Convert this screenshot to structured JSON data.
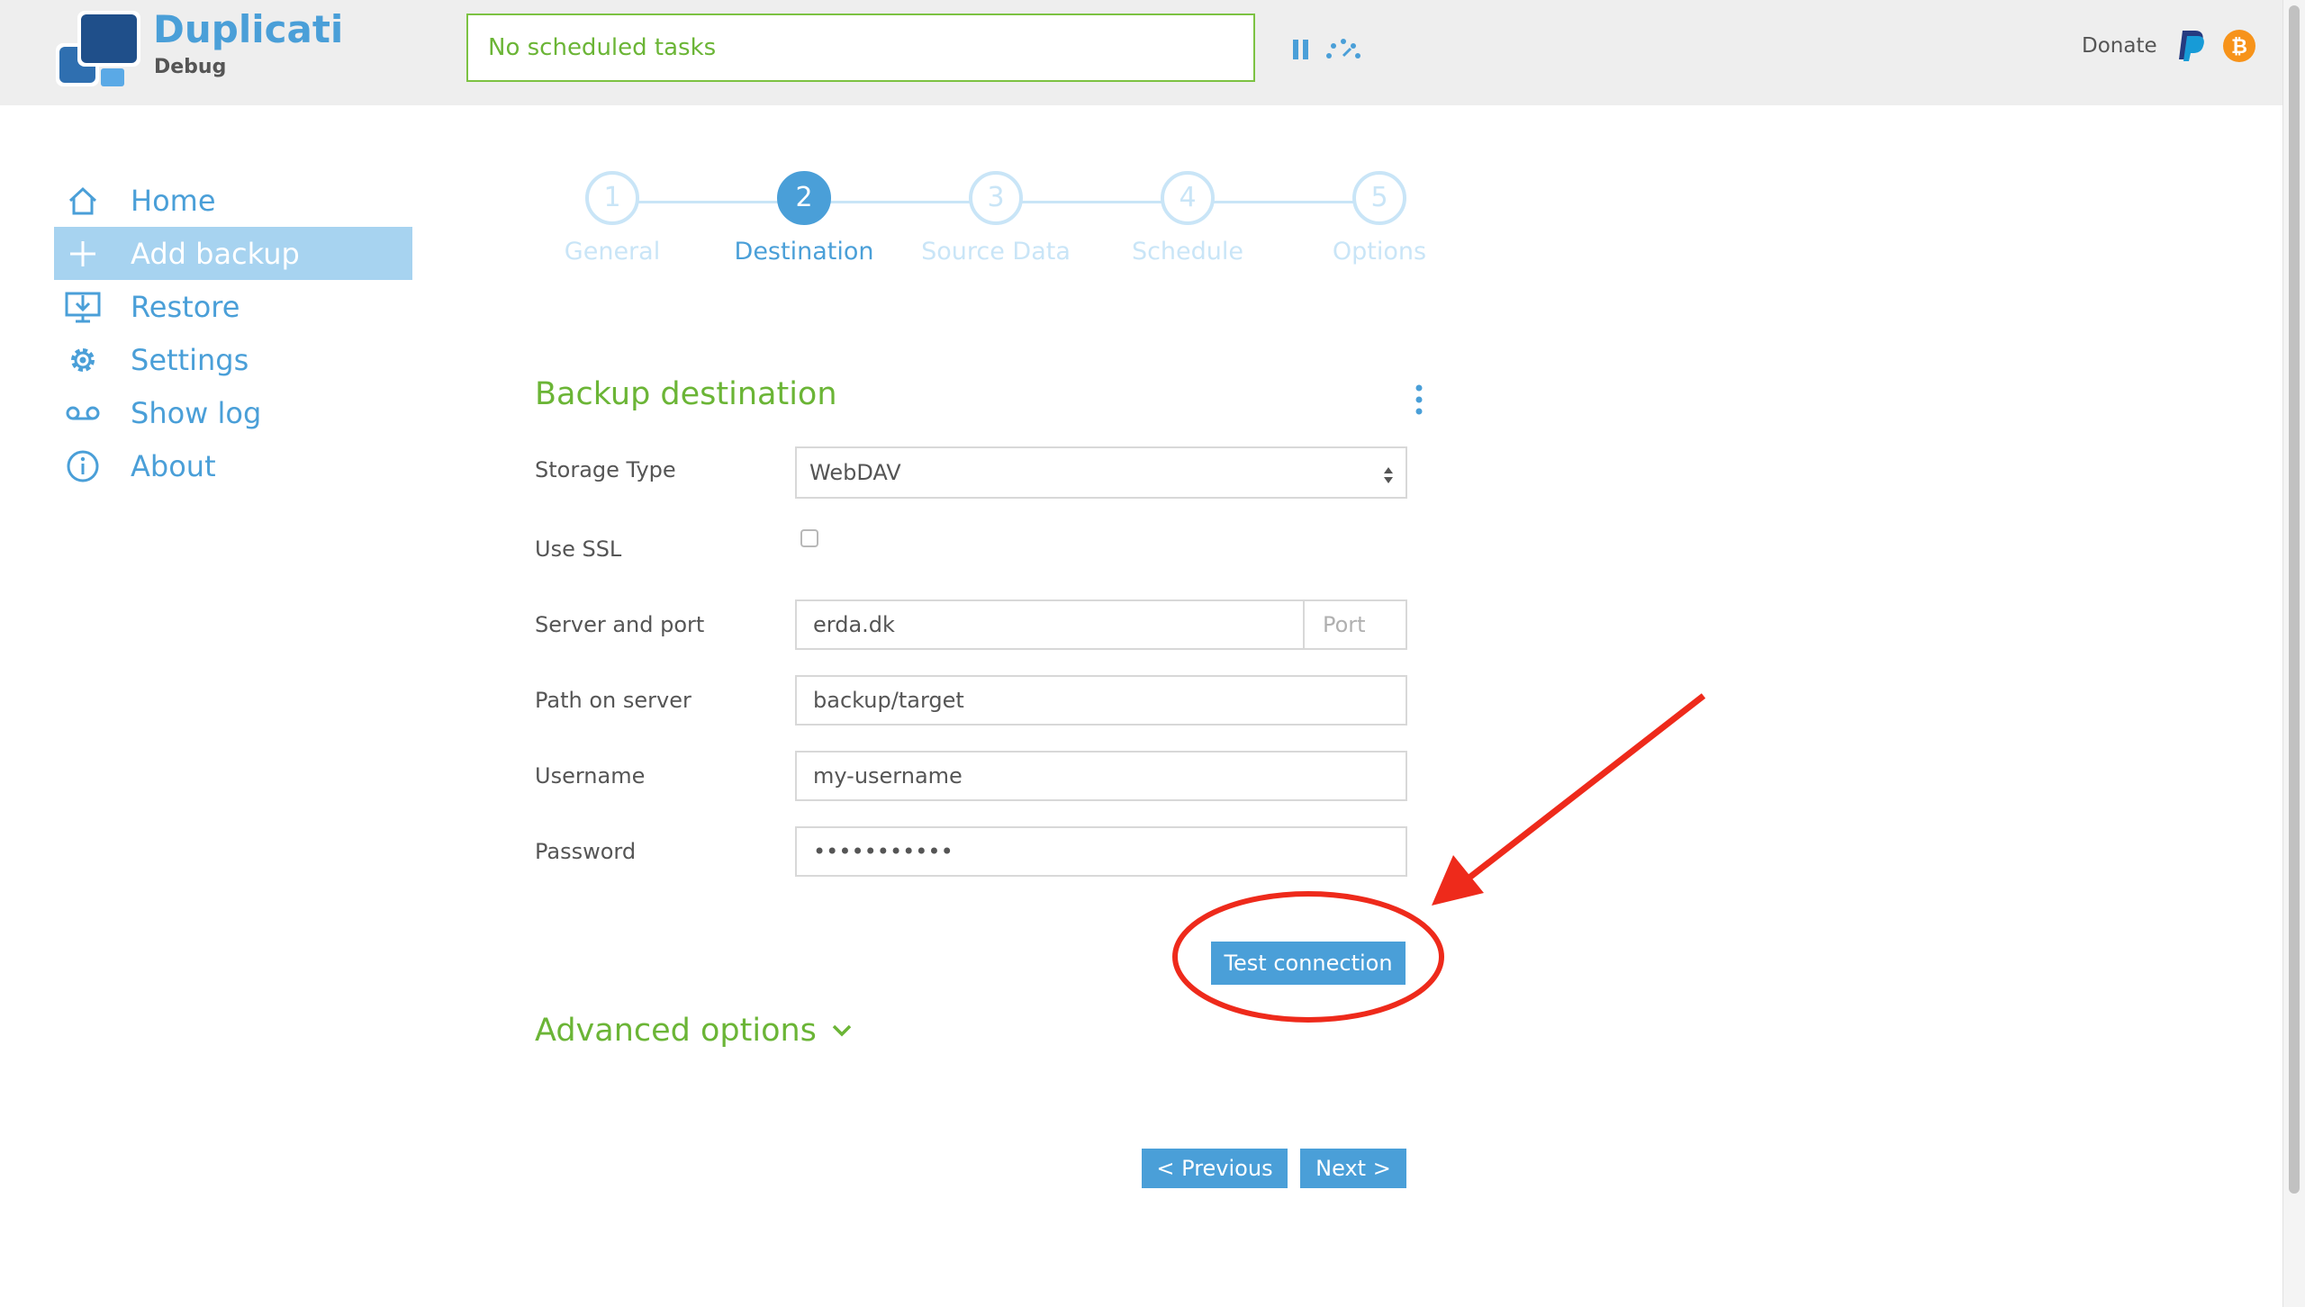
{
  "header": {
    "brand": "Duplicati",
    "subtitle": "Debug",
    "status": "No scheduled tasks",
    "donate_label": "Donate"
  },
  "sidebar": {
    "items": [
      {
        "label": "Home",
        "icon": "home-icon",
        "active": false
      },
      {
        "label": "Add backup",
        "icon": "plus-icon",
        "active": true
      },
      {
        "label": "Restore",
        "icon": "restore-icon",
        "active": false
      },
      {
        "label": "Settings",
        "icon": "gear-icon",
        "active": false
      },
      {
        "label": "Show log",
        "icon": "log-icon",
        "active": false
      },
      {
        "label": "About",
        "icon": "info-icon",
        "active": false
      }
    ]
  },
  "wizard": {
    "steps": [
      {
        "number": "1",
        "label": "General"
      },
      {
        "number": "2",
        "label": "Destination"
      },
      {
        "number": "3",
        "label": "Source Data"
      },
      {
        "number": "4",
        "label": "Schedule"
      },
      {
        "number": "5",
        "label": "Options"
      }
    ],
    "active_step": 2
  },
  "form": {
    "title": "Backup destination",
    "storage_type_label": "Storage Type",
    "storage_type_value": "WebDAV",
    "use_ssl_label": "Use SSL",
    "use_ssl_checked": false,
    "server_label": "Server and port",
    "server_value": "erda.dk",
    "port_placeholder": "Port",
    "path_label": "Path on server",
    "path_value": "backup/target",
    "username_label": "Username",
    "username_value": "my-username",
    "password_label": "Password",
    "password_value": "•••••••••••",
    "test_button": "Test connection",
    "advanced_label": "Advanced options"
  },
  "footer": {
    "previous_label": "< Previous",
    "next_label": "Next >"
  },
  "colors": {
    "accent_blue": "#4a9fd8",
    "accent_green": "#6bb536",
    "annotation_red": "#ee2a1b"
  }
}
